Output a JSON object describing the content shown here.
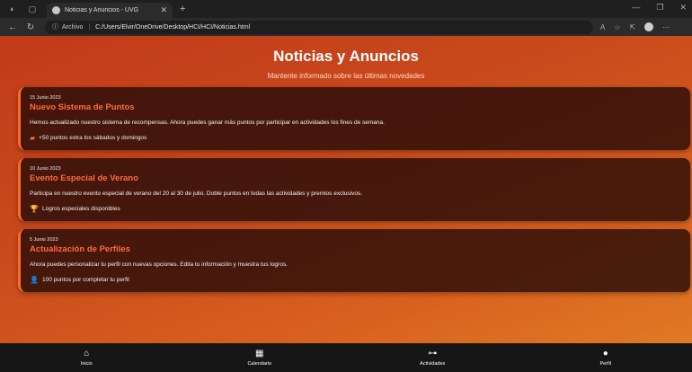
{
  "browser": {
    "tab_title": "Noticias y Anuncios - UVG",
    "url_scheme": "Archivo",
    "url_path": "C:/Users/Elvir/OneDrive/Desktop/HCI/HCI/Noticias.html",
    "icons": [
      "back-icon",
      "refresh-icon",
      "info-icon",
      "read-aloud-icon",
      "favorite-icon",
      "collections-icon",
      "profile-icon",
      "more-icon"
    ]
  },
  "header": {
    "title": "Noticias y Anuncios",
    "subtitle": "Mantente informado sobre las últimas novedades"
  },
  "news": [
    {
      "date": "15 Junio 2023",
      "title": "Nuevo Sistema de Puntos",
      "body": "Hemos actualizado nuestro sistema de recompensas. Ahora puedes ganar más puntos por participar en actividades los fines de semana.",
      "reward_icon": "ticket-icon",
      "reward": "+50 puntos extra los sábados y domingos"
    },
    {
      "date": "10 Junio 2023",
      "title": "Evento Especial de Verano",
      "body": "Participa en nuestro evento especial de verano del 20 al 30 de julio. Doble puntos en todas las actividades y premios exclusivos.",
      "reward_icon": "trophy-icon",
      "reward": "Logros especiales disponibles"
    },
    {
      "date": "5 Junio 2023",
      "title": "Actualización de Perfiles",
      "body": "Ahora puedes personalizar tu perfil con nuevas opciones. Edita tu información y muestra tus logros.",
      "reward_icon": "user-edit-icon",
      "reward": "100 puntos por completar tu perfil"
    }
  ],
  "bottom_nav": [
    {
      "label": "Inicio",
      "icon": "home-icon"
    },
    {
      "label": "Calendario",
      "icon": "calendar-icon"
    },
    {
      "label": "Actividades",
      "icon": "dumbbell-icon"
    },
    {
      "label": "Perfil",
      "icon": "user-icon"
    }
  ],
  "colors": {
    "accent": "#ff6b3a",
    "card_bg": "#280c08",
    "nav_bg": "#161616"
  }
}
